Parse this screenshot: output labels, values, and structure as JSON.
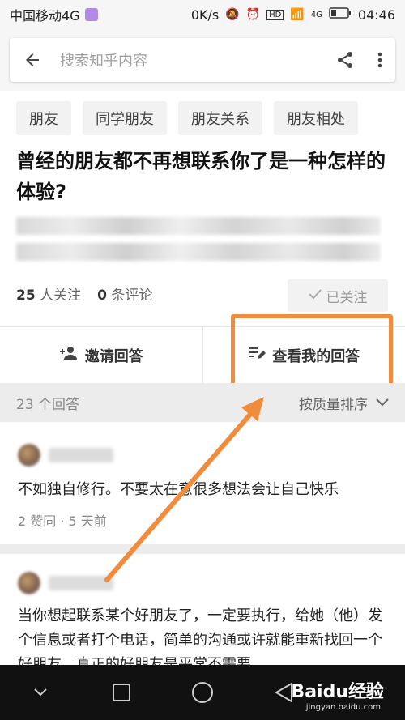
{
  "status_bar": {
    "carrier": "中国移动4G",
    "speed": "0K/s",
    "network_badge": "HD",
    "signal_label": "4G",
    "time": "04:46"
  },
  "search": {
    "placeholder": "搜索知乎内容"
  },
  "tags": [
    "朋友",
    "同学朋友",
    "朋友关系",
    "朋友相处"
  ],
  "question": {
    "title": "曾经的朋友都不再想联系你了是一种怎样的体验?",
    "followers_count": "25",
    "followers_label": "人关注",
    "comments_count": "0",
    "comments_label": "条评论",
    "follow_button": "已关注"
  },
  "actions": {
    "invite": "邀请回答",
    "view_my_answer": "查看我的回答"
  },
  "answers_header": {
    "count_text": "23 个回答",
    "sort_text": "按质量排序"
  },
  "answers": [
    {
      "text": "不如独自修行。不要太在意很多想法会让自己快乐",
      "meta": "2 赞同 · 5 天前"
    },
    {
      "text": "当你想起联系某个好朋友了，一定要执行，给她（他）发个信息或者打个电话，简单的沟通或许就能重新找回一个好朋友。真正的好朋友是平常不需要..."
    }
  ],
  "watermark": {
    "brand": "Baidu经验",
    "url": "jingyan.baidu.com"
  },
  "colors": {
    "highlight": "#f08c3c",
    "nav_bar": "#111111"
  }
}
